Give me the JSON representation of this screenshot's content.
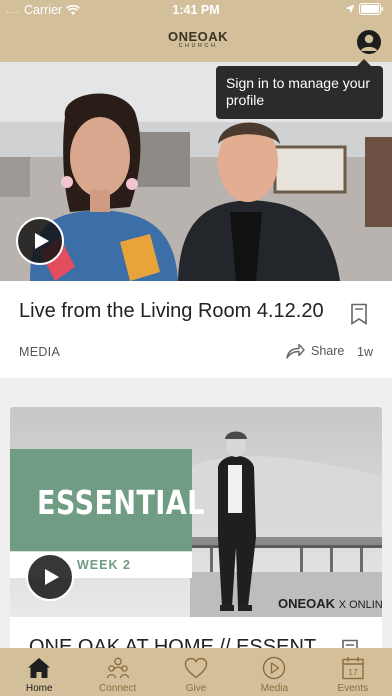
{
  "status_bar": {
    "carrier": "Carrier",
    "time": "1:41 PM",
    "signal_icon": "signal-dots-icon",
    "wifi_icon": "wifi-icon",
    "location_icon": "location-arrow-icon",
    "battery_icon": "battery-icon"
  },
  "header": {
    "logo_line1": "ONEOAK",
    "logo_line2": "CHURCH",
    "profile_icon": "user-profile-icon",
    "background": "#d3bf99"
  },
  "tooltip": {
    "text": "Sign in to manage your profile"
  },
  "feed": [
    {
      "title": "Live from the Living Room 4.12.20",
      "category": "MEDIA",
      "share_label": "Share",
      "age": "1w"
    },
    {
      "title": "ONE OAK AT HOME // ESSENT",
      "thumbnail_heading": "ESSENTIAL",
      "thumbnail_subheading": "WEEK 2",
      "thumbnail_brand": "ONEOAK",
      "thumbnail_brand_suffix": "X ONLINE",
      "accent": "#6f9c82"
    }
  ],
  "tabbar": {
    "items": [
      {
        "label": "Home",
        "icon": "home-icon",
        "active": true
      },
      {
        "label": "Connect",
        "icon": "people-icon",
        "active": false
      },
      {
        "label": "Give",
        "icon": "heart-icon",
        "active": false
      },
      {
        "label": "Media",
        "icon": "play-circle-icon",
        "active": false
      },
      {
        "label": "Events",
        "icon": "calendar-icon",
        "active": false
      }
    ],
    "active_color": "#1f1f1f",
    "inactive_color": "#8d6d3e"
  }
}
